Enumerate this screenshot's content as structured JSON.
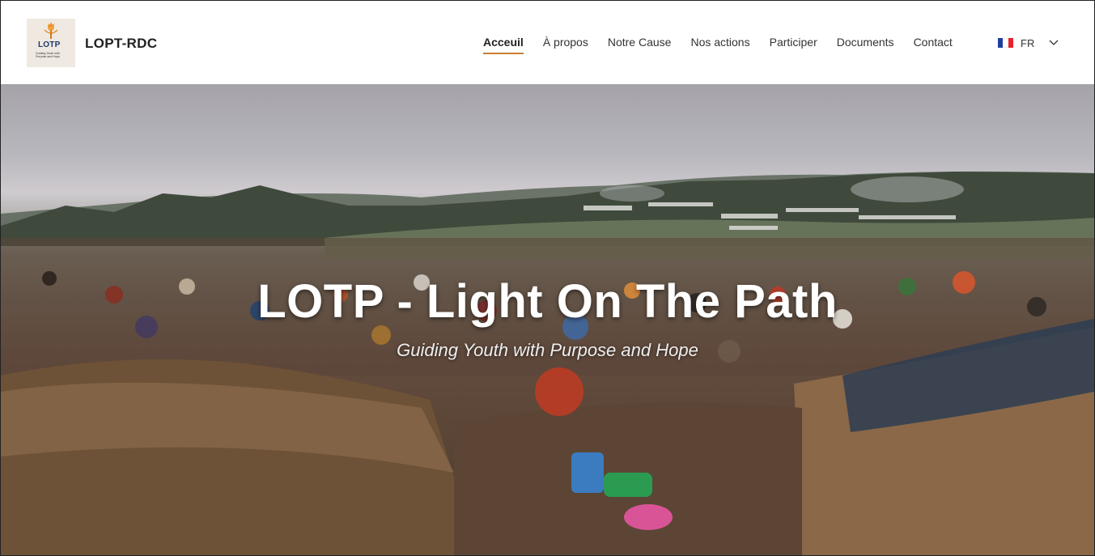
{
  "header": {
    "logo": {
      "text": "LOTP",
      "tagline": "Guiding Youth with Purpose and Hope"
    },
    "brand": "LOPT-RDC",
    "nav": [
      {
        "label": "Acceuil",
        "active": true
      },
      {
        "label": "À propos"
      },
      {
        "label": "Notre Cause"
      },
      {
        "label": "Nos actions"
      },
      {
        "label": "Participer"
      },
      {
        "label": "Documents"
      },
      {
        "label": "Contact"
      }
    ],
    "language": {
      "label": "FR",
      "flag": "france-flag",
      "flag_colors": [
        "#1f3f9e",
        "#ffffff",
        "#e8212b"
      ]
    }
  },
  "hero": {
    "title": "LOTP - Light On The Path",
    "subtitle": "Guiding Youth with Purpose and Hope",
    "image": "refugee-camp-photo"
  },
  "colors": {
    "accent": "#c87f2e",
    "text": "#333333"
  }
}
